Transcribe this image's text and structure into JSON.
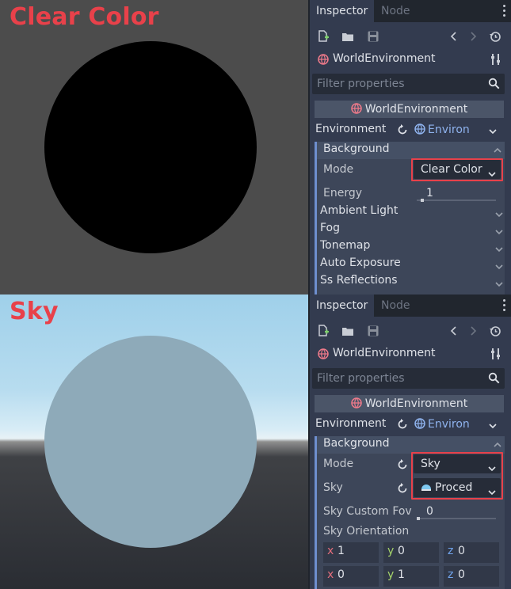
{
  "top": {
    "caption": "Clear Color",
    "inspector": {
      "tabs": [
        "Inspector",
        "Node"
      ],
      "object_name": "WorldEnvironment",
      "filter_placeholder": "Filter properties",
      "resource_header": "WorldEnvironment",
      "environment_label": "Environment",
      "environment_value": "Environ",
      "background_group": "Background",
      "mode_label": "Mode",
      "mode_value": "Clear Color",
      "energy_label": "Energy",
      "energy_value": "1",
      "sections": [
        "Ambient Light",
        "Fog",
        "Tonemap",
        "Auto Exposure",
        "Ss Reflections"
      ]
    }
  },
  "bottom": {
    "caption": "Sky",
    "inspector": {
      "tabs": [
        "Inspector",
        "Node"
      ],
      "object_name": "WorldEnvironment",
      "filter_placeholder": "Filter properties",
      "resource_header": "WorldEnvironment",
      "environment_label": "Environment",
      "environment_value": "Environ",
      "background_group": "Background",
      "mode_label": "Mode",
      "mode_value": "Sky",
      "sky_label": "Sky",
      "sky_value": "Proced",
      "sky_fov_label": "Sky Custom Fov",
      "sky_fov_value": "0",
      "sky_orientation_label": "Sky Orientation",
      "orientation_rows": [
        {
          "x": "1",
          "y": "0",
          "z": "0"
        },
        {
          "x": "0",
          "y": "1",
          "z": "0"
        }
      ],
      "axis_labels": [
        "x",
        "y",
        "z"
      ]
    }
  },
  "colors": {
    "accent_red": "#e8414a",
    "panel_bg": "#333b4f",
    "link_blue": "#8fb3ee"
  }
}
